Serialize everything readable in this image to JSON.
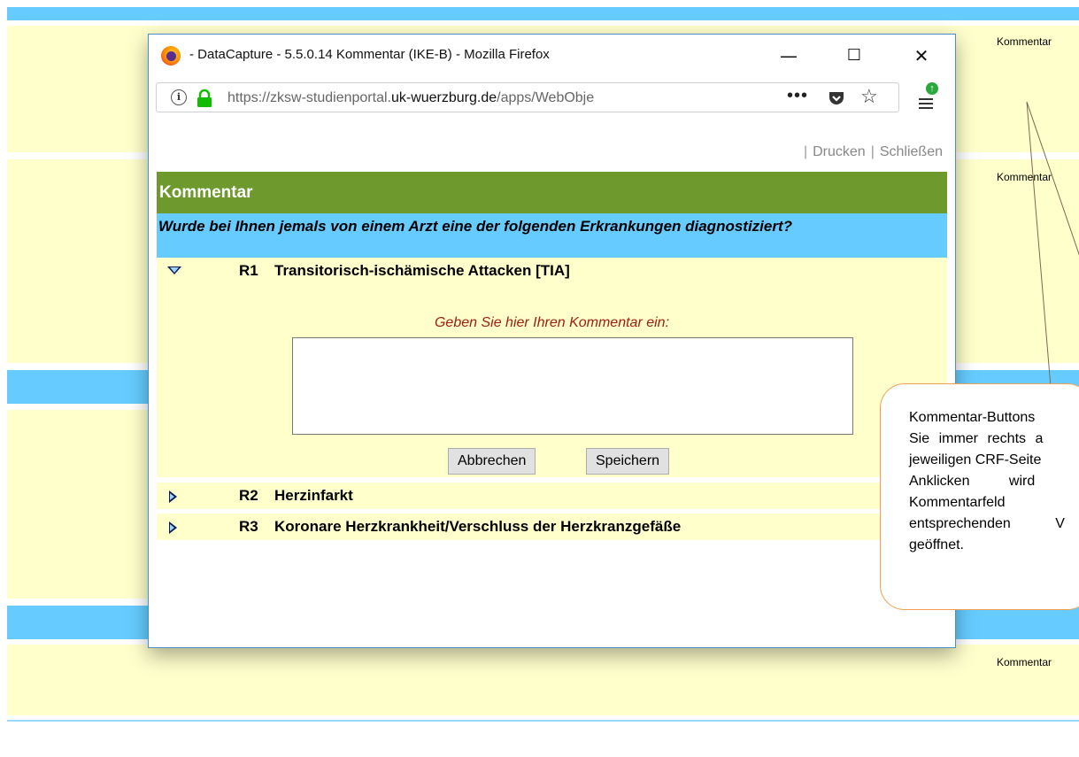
{
  "background": {
    "comment_labels": [
      "Kommentar",
      "Kommentar",
      "Kommentar"
    ],
    "colors": {
      "band_blue": "#66ccff",
      "band_yellow": "#ffffcc"
    }
  },
  "window": {
    "title": "- DataCapture - 5.5.0.14 Kommentar (IKE-B) - Mozilla Firefox",
    "controls": {
      "minimize": "—",
      "maximize": "☐",
      "close": "✕"
    },
    "url_prefix": "https://zksw-studienportal.",
    "url_domain": "uk-wuerzburg.de",
    "url_suffix": "/apps/WebObje",
    "url_more": "•••"
  },
  "page": {
    "links": {
      "print": "Drucken",
      "close": "Schließen"
    },
    "header": "Kommentar",
    "question": "Wurde bei Ihnen jemals von einem Arzt eine der folgenden Erkrankungen diagnostiziert?",
    "rows": [
      {
        "code": "R1",
        "label": "Transitorisch-ischämische Attacken [TIA]",
        "expanded": true
      },
      {
        "code": "R2",
        "label": "Herzinfarkt",
        "expanded": false
      },
      {
        "code": "R3",
        "label": "Koronare Herzkrankheit/Verschluss der Herzkranzgefäße",
        "expanded": false
      }
    ],
    "comment_prompt": "Geben Sie hier Ihren Kommentar ein:",
    "comment_value": "",
    "buttons": {
      "cancel": "Abbrechen",
      "save": "Speichern"
    },
    "colors": {
      "header_green": "#6e9a2d",
      "question_blue": "#66ccff",
      "row_yellow": "#ffffcc",
      "prompt_red": "#a02010"
    }
  },
  "callout": {
    "lines": [
      "Kommentar-Buttons",
      "Sie immer rechts a",
      "jeweiligen CRF-Seite",
      "Anklicken wird",
      "Kommentarfeld",
      "entsprechenden V",
      "geöffnet."
    ],
    "border_color": "#f0a050"
  }
}
